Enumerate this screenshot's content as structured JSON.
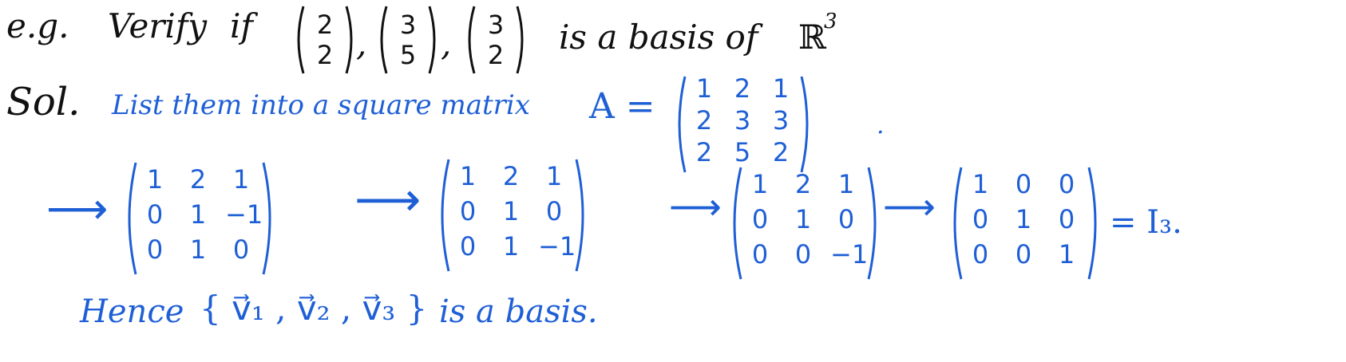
{
  "colors": {
    "ink_black": "#111111",
    "ink_blue": "#1f5fd6"
  },
  "example": {
    "prefix": "e.g.",
    "verb": "Verify",
    "if": "if",
    "vectors": [
      [
        "2",
        "2"
      ],
      [
        "3",
        "5"
      ],
      [
        "3",
        "2"
      ]
    ],
    "sep": ",",
    "suffix": "is a basis of",
    "space": "ℝ",
    "exponent": "3"
  },
  "solution": {
    "label": "Sol.",
    "instruction": "List them into a square matrix",
    "matrix_name": "A =",
    "matrix_A": [
      [
        "1",
        "2",
        "1"
      ],
      [
        "2",
        "3",
        "3"
      ],
      [
        "2",
        "5",
        "2"
      ]
    ]
  },
  "reduction": {
    "arrow": "⟶",
    "steps": [
      [
        [
          "1",
          "2",
          "1"
        ],
        [
          "0",
          "1",
          "−1"
        ],
        [
          "0",
          "1",
          "0"
        ]
      ],
      [
        [
          "1",
          "2",
          "1"
        ],
        [
          "0",
          "1",
          "0"
        ],
        [
          "0",
          "1",
          "−1"
        ]
      ],
      [
        [
          "1",
          "2",
          "1"
        ],
        [
          "0",
          "1",
          "0"
        ],
        [
          "0",
          "0",
          "−1"
        ]
      ],
      [
        [
          "1",
          "0",
          "0"
        ],
        [
          "0",
          "1",
          "0"
        ],
        [
          "0",
          "0",
          "1"
        ]
      ]
    ],
    "result": "= I₃."
  },
  "conclusion": {
    "hence": "Hence",
    "set": "{ v⃗₁ , v⃗₂ , v⃗₃ }",
    "text": "is a basis."
  }
}
